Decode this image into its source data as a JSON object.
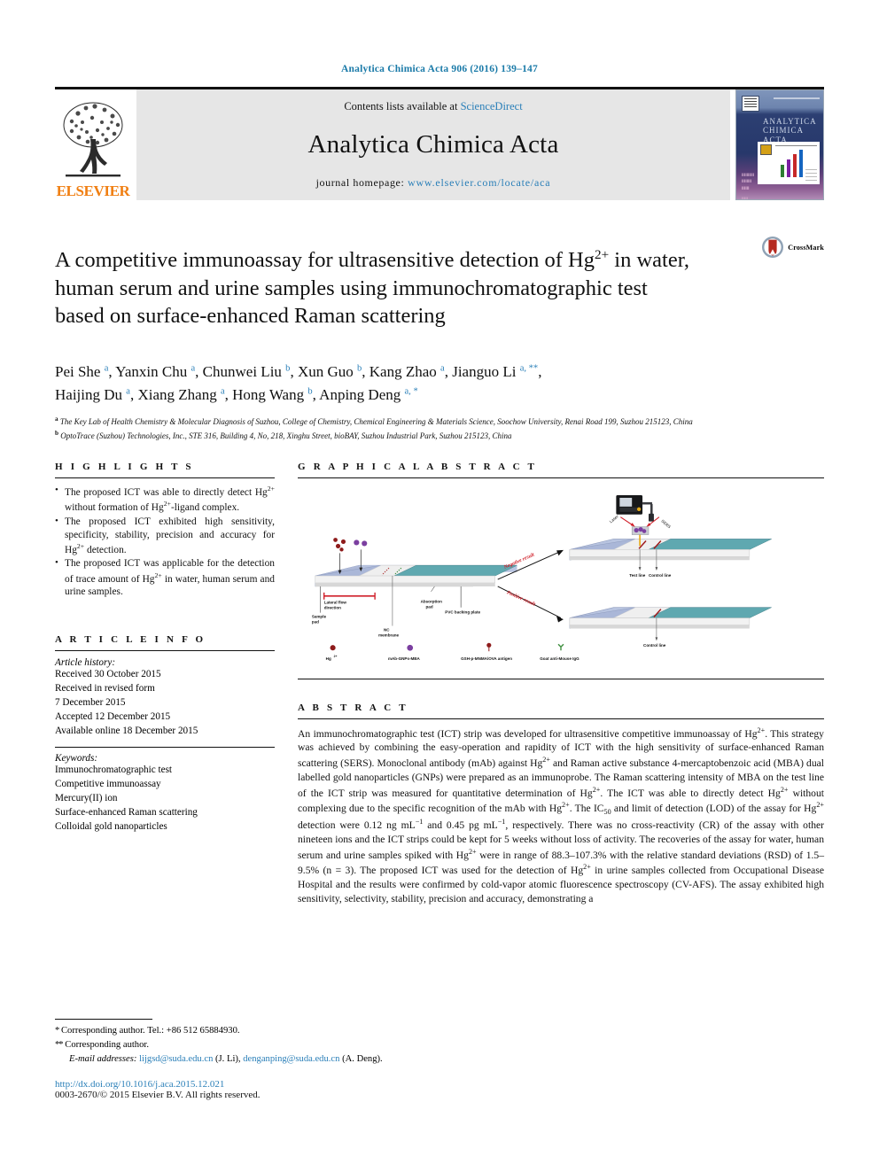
{
  "running_head": "Analytica Chimica Acta 906 (2016) 139–147",
  "masthead": {
    "publisher": "ELSEVIER",
    "contents_prefix": "Contents lists available at ",
    "contents_link": "ScienceDirect",
    "journal_title": "Analytica Chimica Acta",
    "homepage_prefix": "journal homepage: ",
    "homepage_url": "www.elsevier.com/locate/aca",
    "cover_title": "ANALYTICA CHIMICA ACTA"
  },
  "article": {
    "title_part1": "A competitive immunoassay for ultrasensitive detection of Hg",
    "title_sup": "2+",
    "title_part2": " in water, human serum and urine samples using immunochromatographic test based on surface-enhanced Raman scattering",
    "crossmark_label": "CrossMark",
    "authors_line1": "Pei She a, Yanxin Chu a, Chunwei Liu b, Xun Guo b, Kang Zhao a, Jianguo Li a, **,",
    "authors_line2": "Haijing Du a, Xiang Zhang a, Hong Wang b, Anping Deng a, *",
    "authors": [
      {
        "name": "Pei She",
        "marks": "a"
      },
      {
        "name": "Yanxin Chu",
        "marks": "a"
      },
      {
        "name": "Chunwei Liu",
        "marks": "b"
      },
      {
        "name": "Xun Guo",
        "marks": "b"
      },
      {
        "name": "Kang Zhao",
        "marks": "a"
      },
      {
        "name": "Jianguo Li",
        "marks": "a, **"
      },
      {
        "name": "Haijing Du",
        "marks": "a"
      },
      {
        "name": "Xiang Zhang",
        "marks": "a"
      },
      {
        "name": "Hong Wang",
        "marks": "b"
      },
      {
        "name": "Anping Deng",
        "marks": "a, *"
      }
    ],
    "affiliations": [
      {
        "mark": "a",
        "text": "The Key Lab of Health Chemistry & Molecular Diagnosis of Suzhou, College of Chemistry, Chemical Engineering & Materials Science, Soochow University, Renai Road 199, Suzhou 215123, China"
      },
      {
        "mark": "b",
        "text": "OptoTrace (Suzhou) Technologies, Inc., STE 316, Building 4, No, 218, Xinghu Street, bioBAY, Suzhou Industrial Park, Suzhou 215123, China"
      }
    ]
  },
  "sections": {
    "highlights_head": "H I G H L I G H T S",
    "graphical_abstract_head": "G R A P H I C A L   A B S T R A C T",
    "article_info_head": "A R T I C L E   I N F O",
    "abstract_head": "A B S T R A C T"
  },
  "highlights": [
    "The proposed ICT was able to directly detect Hg2+ without formation of Hg2+-ligand complex.",
    "The proposed ICT exhibited high sensitivity, specificity, stability, precision and accuracy for Hg2+ detection.",
    "The proposed ICT was applicable for the detection of trace amount of Hg2+ in water, human serum and urine samples."
  ],
  "article_info": {
    "history_label": "Article history:",
    "history": [
      "Received 30 October 2015",
      "Received in revised form",
      "7 December 2015",
      "Accepted 12 December 2015",
      "Available online 18 December 2015"
    ],
    "keywords_label": "Keywords:",
    "keywords": [
      "Immunochromatographic test",
      "Competitive immunoassay",
      "Mercury(II) ion",
      "Surface-enhanced Raman scattering",
      "Colloidal gold nanoparticles"
    ]
  },
  "abstract_text": "An immunochromatographic test (ICT) strip was developed for ultrasensitive competitive immunoassay of Hg2+. This strategy was achieved by combining the easy-operation and rapidity of ICT with the high sensitivity of surface-enhanced Raman scattering (SERS). Monoclonal antibody (mAb) against Hg2+ and Raman active substance 4-mercaptobenzoic acid (MBA) dual labelled gold nanoparticles (GNPs) were prepared as an immunoprobe. The Raman scattering intensity of MBA on the test line of the ICT strip was measured for quantitative determination of Hg2+. The ICT was able to directly detect Hg2+ without complexing due to the specific recognition of the mAb with Hg2+. The IC50 and limit of detection (LOD) of the assay for Hg2+ detection were 0.12 ng mL-1 and 0.45 pg mL-1, respectively. There was no cross-reactivity (CR) of the assay with other nineteen ions and the ICT strips could be kept for 5 weeks without loss of activity. The recoveries of the assay for water, human serum and urine samples spiked with Hg2+ were in range of 88.3-107.3% with the relative standard deviations (RSD) of 1.5-9.5% (n = 3). The proposed ICT was used for the detection of Hg2+ in urine samples collected from Occupational Disease Hospital and the results were confirmed by cold-vapor atomic fluorescence spectroscopy (CV-AFS). The assay exhibited high sensitivity, selectivity, stability, precision and accuracy, demonstrating a",
  "figure": {
    "labels": {
      "lateral_flow": "Lateral flow direction",
      "sample_pad": "Sample pad",
      "nc_membrane": "NC membrane",
      "absorption_pad": "Absorption pad",
      "pvc_plate": "PVC backing plate",
      "negative_result": "Negative result",
      "positive_result": "Positive result",
      "test_line": "Test line",
      "control_line": "Control line",
      "control_line_only": "Control line"
    },
    "legend": [
      "Hg2+",
      "mAb-GNPs-MBA",
      "GSH-p-MNMA/OVA antigen",
      "Goat anti-Mouse IgG"
    ]
  },
  "footer": {
    "corr1": "Corresponding author. Tel.: +86 512 65884930.",
    "corr1_mark": "*",
    "corr2": "Corresponding author.",
    "corr2_mark": "**",
    "email_label": "E-mail addresses:",
    "email1": "lijgsd@suda.edu.cn",
    "email1_owner": "(J. Li),",
    "email2": "denganping@suda.edu.cn",
    "email2_owner": "(A. Deng).",
    "doi": "http://dx.doi.org/10.1016/j.aca.2015.12.021",
    "copyright": "0003-2670/© 2015 Elsevier B.V. All rights reserved."
  },
  "colors": {
    "link_blue": "#2a7fb8",
    "elsevier_orange": "#f07f13",
    "banner_gray": "#e6e6e6",
    "figure_red": "#d0202a"
  }
}
